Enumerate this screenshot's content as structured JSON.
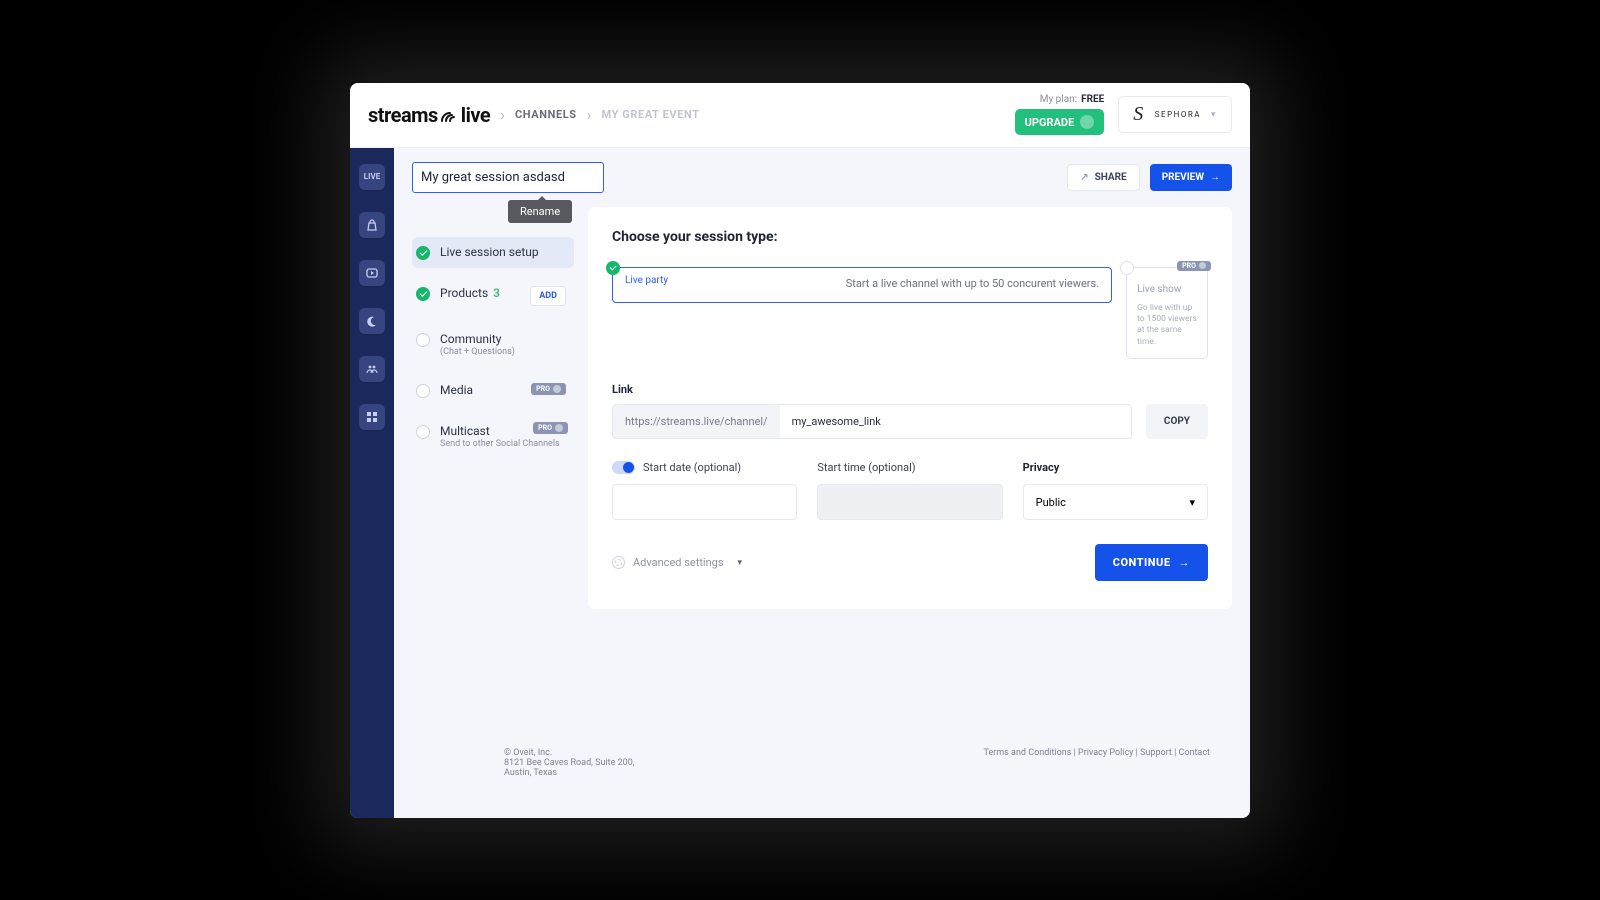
{
  "header": {
    "logo": "streams",
    "logo_suffix": "live",
    "breadcrumb": {
      "channels": "CHANNELS",
      "event": "MY GREAT EVENT"
    },
    "plan_label": "My plan:",
    "plan_value": "FREE",
    "upgrade": "UPGRADE",
    "brand": "SEPHORA"
  },
  "rail": {
    "live": "LIVE"
  },
  "title": {
    "value": "My great session asdasd",
    "tooltip": "Rename"
  },
  "actions": {
    "share": "SHARE",
    "preview": "PREVIEW"
  },
  "steps": {
    "setup": "Live session setup",
    "products": "Products",
    "products_count": "3",
    "products_add": "ADD",
    "community": "Community",
    "community_sub": "(Chat + Questions)",
    "media": "Media",
    "multicast": "Multicast",
    "multicast_sub": "Send to other Social Channels",
    "pro": "PRO"
  },
  "card": {
    "heading": "Choose your session type:",
    "type1_title": "Live party",
    "type1_desc": "Start a live channel with up to 50 concurent viewers.",
    "type2_title": "Live show",
    "type2_desc": "Go live with up to 1500 viewers at the same time.",
    "link_label": "Link",
    "link_prefix": "https://streams.live/channel/",
    "link_value": "my_awesome_link",
    "copy": "COPY",
    "start_date": "Start date (optional)",
    "start_time": "Start time (optional)",
    "privacy_label": "Privacy",
    "privacy_value": "Public",
    "advanced": "Advanced settings",
    "continue": "CONTINUE"
  },
  "footer": {
    "l1": "© Oveit, Inc.",
    "l2": "8121 Bee Caves Road, Suite 200,",
    "l3": "Austin, Texas",
    "terms": "Terms and Conditions",
    "privacy": "Privacy Policy",
    "support": "Support",
    "contact": "Contact"
  }
}
